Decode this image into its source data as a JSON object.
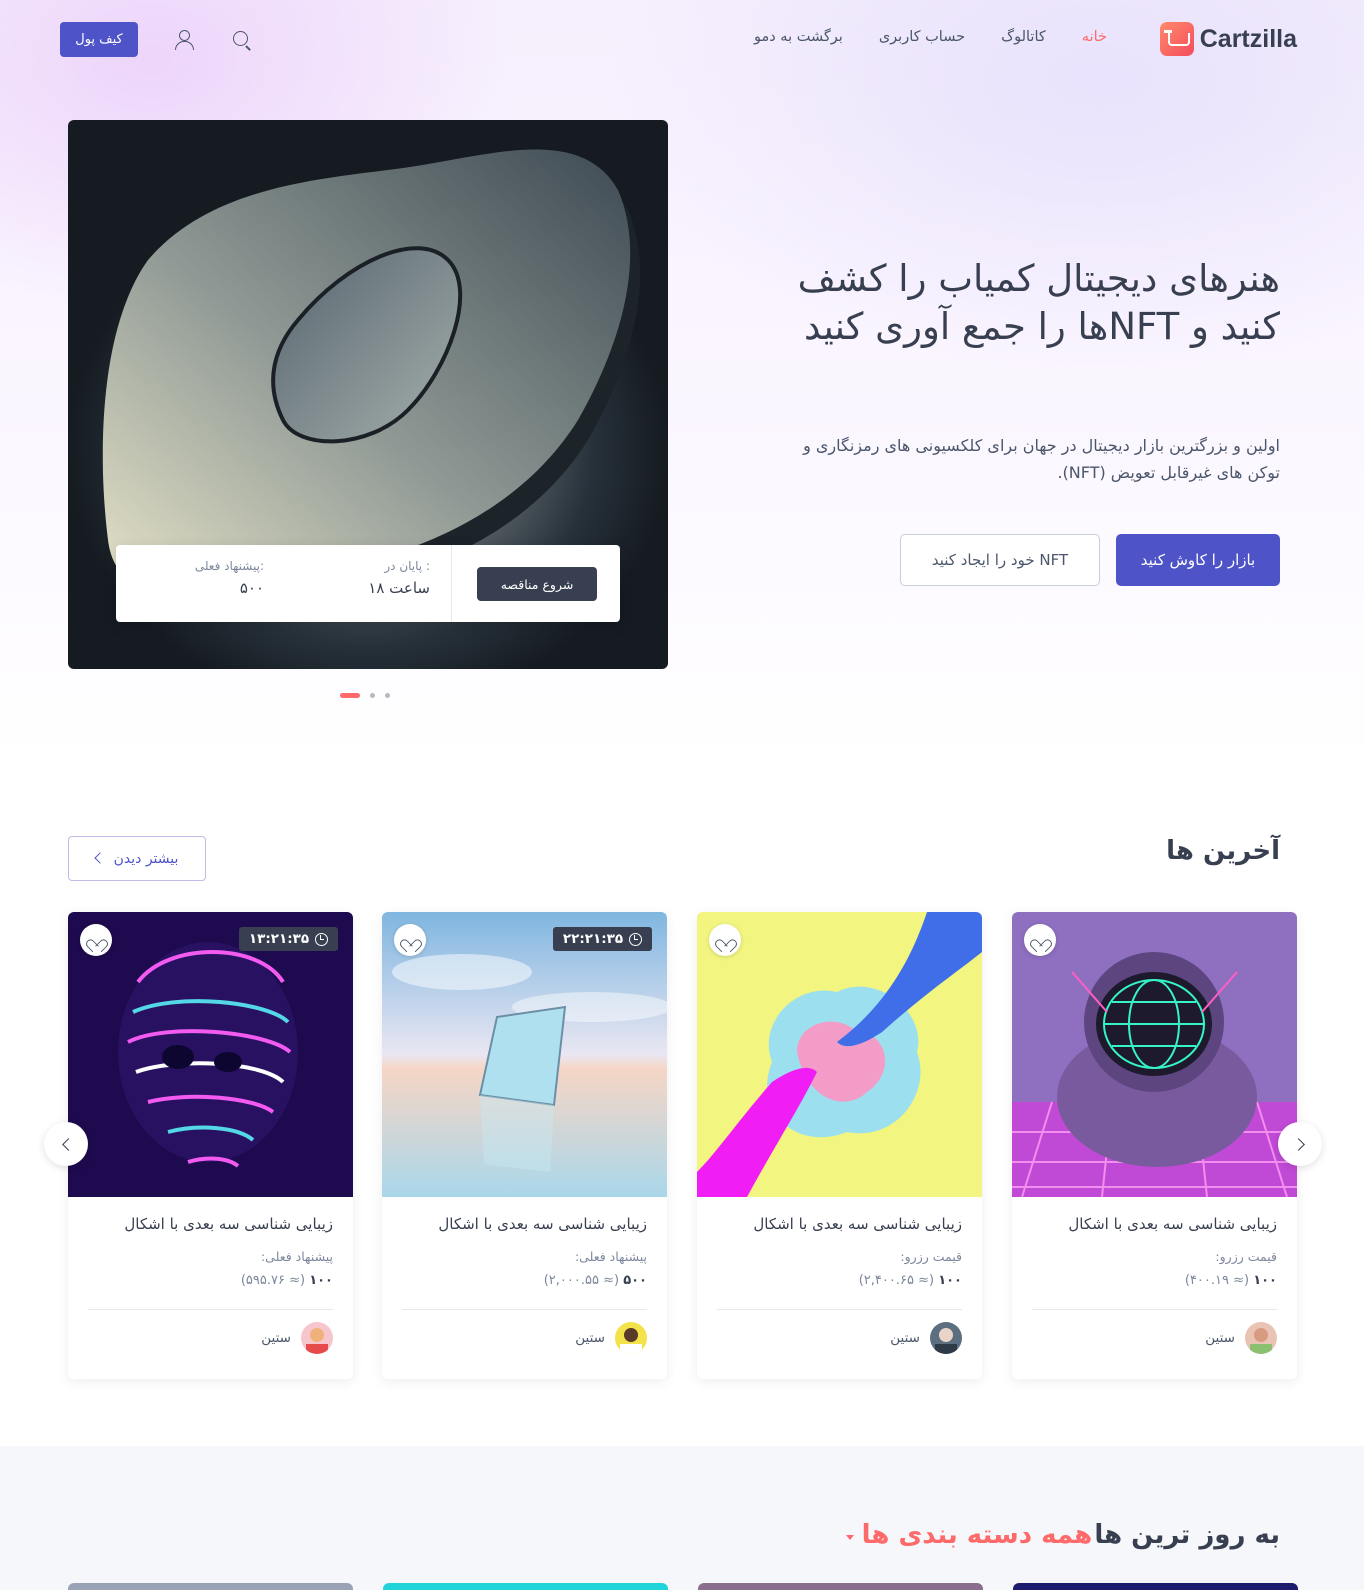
{
  "header": {
    "logo_text": "Cartzilla",
    "nav": [
      "خانه",
      "کاتالوگ",
      "حساب کاربری",
      "برگشت به دمو"
    ],
    "wallet_label": "کیف پول"
  },
  "hero": {
    "title": "هنرهای دیجیتال کمیاب را کشف کنید و NFTها را جمع آوری کنید",
    "description": "اولین و بزرگترین بازار دیجیتال در جهان برای کلکسیونی های رمزنگاری و توکن های غیرقابل تعویض (NFT).",
    "primary_button": "بازار را کاوش کنید",
    "secondary_button": "NFT خود را ایجاد کنید",
    "auction": {
      "current_bid_label": ":پیشنهاد فعلی",
      "current_bid_value": "۵۰۰",
      "ends_label": ": پایان در",
      "ends_value": "ساعت ۱۸",
      "button": "شروع مناقصه"
    },
    "slides_count": 3,
    "active_slide": 1
  },
  "latest": {
    "title": "آخرین ها",
    "more_label": "بیشتر دیدن",
    "items": [
      {
        "title": "زیبایی شناسی سه بعدی با اشکال",
        "price_label": "قیمت رزرو:",
        "price": "۱۰۰",
        "price_fiat": "(≈ ۴۰۰.۱۹)",
        "author": "ستین",
        "timer": ""
      },
      {
        "title": "زیبایی شناسی سه بعدی با اشکال",
        "price_label": "قیمت رزرو:",
        "price": "۱۰۰",
        "price_fiat": "(≈ ۲,۴۰۰.۶۵)",
        "author": "ستین",
        "timer": ""
      },
      {
        "title": "زیبایی شناسی سه بعدی با اشکال",
        "price_label": "پیشنهاد فعلی:",
        "price": "۵۰۰",
        "price_fiat": "(≈ ۲,۰۰۰.۵۵)",
        "author": "ستین",
        "timer": "۲۲:۲۱:۳۵"
      },
      {
        "title": "زیبایی شناسی سه بعدی با اشکال",
        "price_label": "پیشنهاد فعلی:",
        "price": "۱۰۰",
        "price_fiat": "(≈ ۵۹۵.۷۶)",
        "author": "ستین",
        "timer": "۱۳:۲۱:۳۵"
      }
    ]
  },
  "trending": {
    "title_prefix": "به روز ترین ها",
    "title_accent": "همه دسته بندی ها"
  },
  "colors": {
    "primary": "#4e54c8",
    "accent": "#fe696a",
    "text": "#373f50"
  },
  "icons": [
    "search-icon",
    "user-icon",
    "heart-icon",
    "clock-icon",
    "chevron-left-icon",
    "chevron-right-icon"
  ]
}
